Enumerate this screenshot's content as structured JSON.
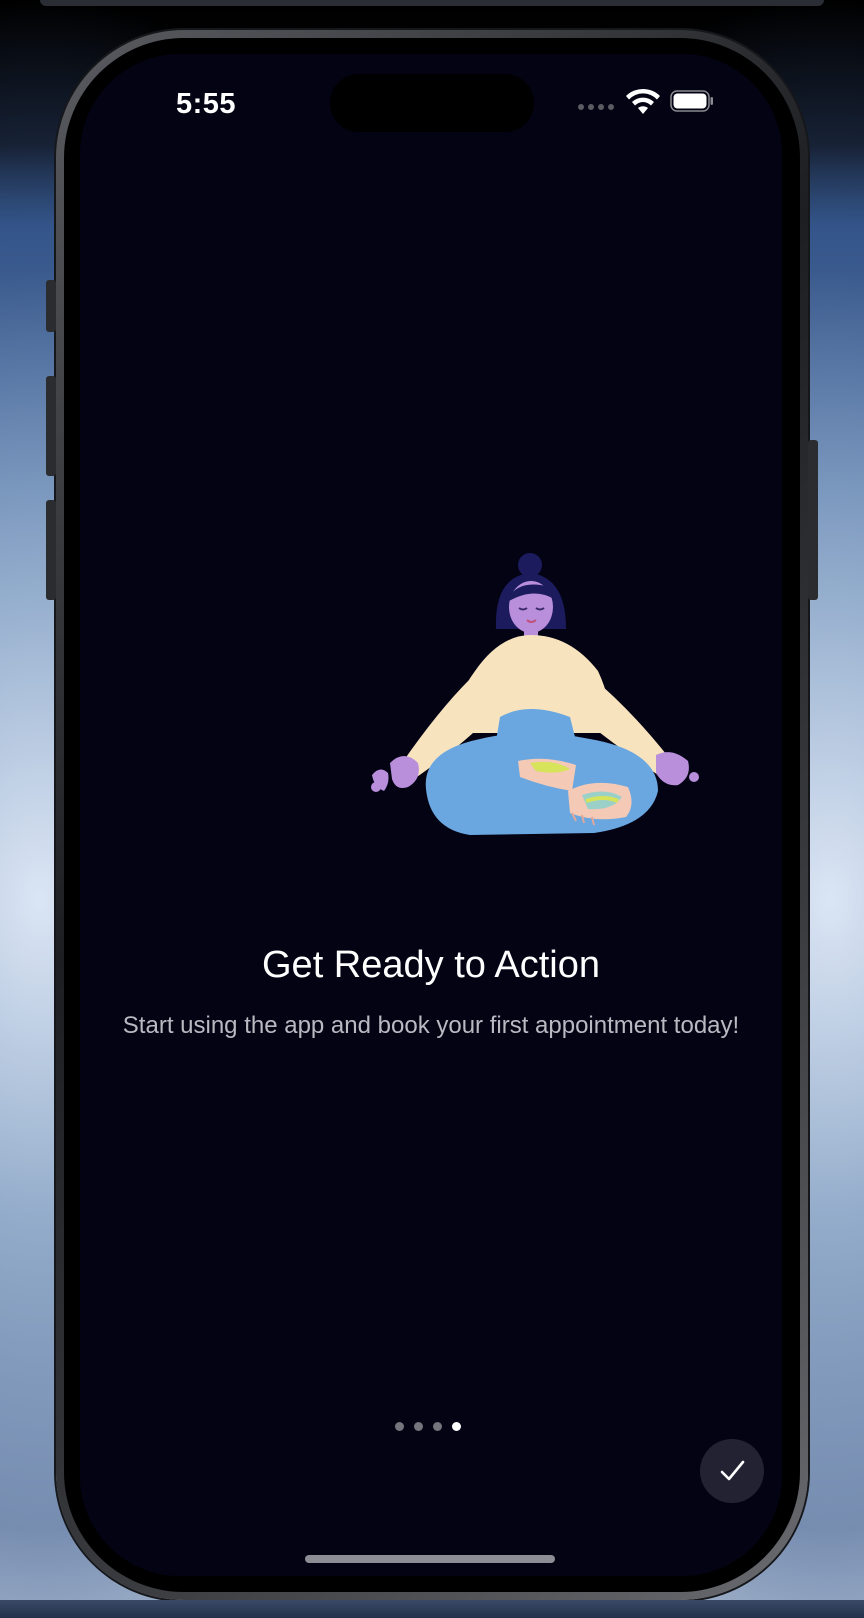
{
  "status_bar": {
    "time": "5:55",
    "icons": [
      "signal-dots-icon",
      "wifi-icon",
      "battery-icon"
    ]
  },
  "onboarding": {
    "illustration": "meditating-person-illustration",
    "title": "Get Ready to Action",
    "subtitle": "Start using the app and book your first appointment today!"
  },
  "pager": {
    "total_pages": 4,
    "current_page": 4
  },
  "done_button": {
    "icon": "checkmark-icon"
  },
  "colors": {
    "screen_background": "#040314",
    "title_text": "#ffffff",
    "subtitle_text": "#b9b9c2",
    "active_dot": "#ffffff",
    "inactive_dot": "#75757d",
    "button_background": "#232232"
  }
}
